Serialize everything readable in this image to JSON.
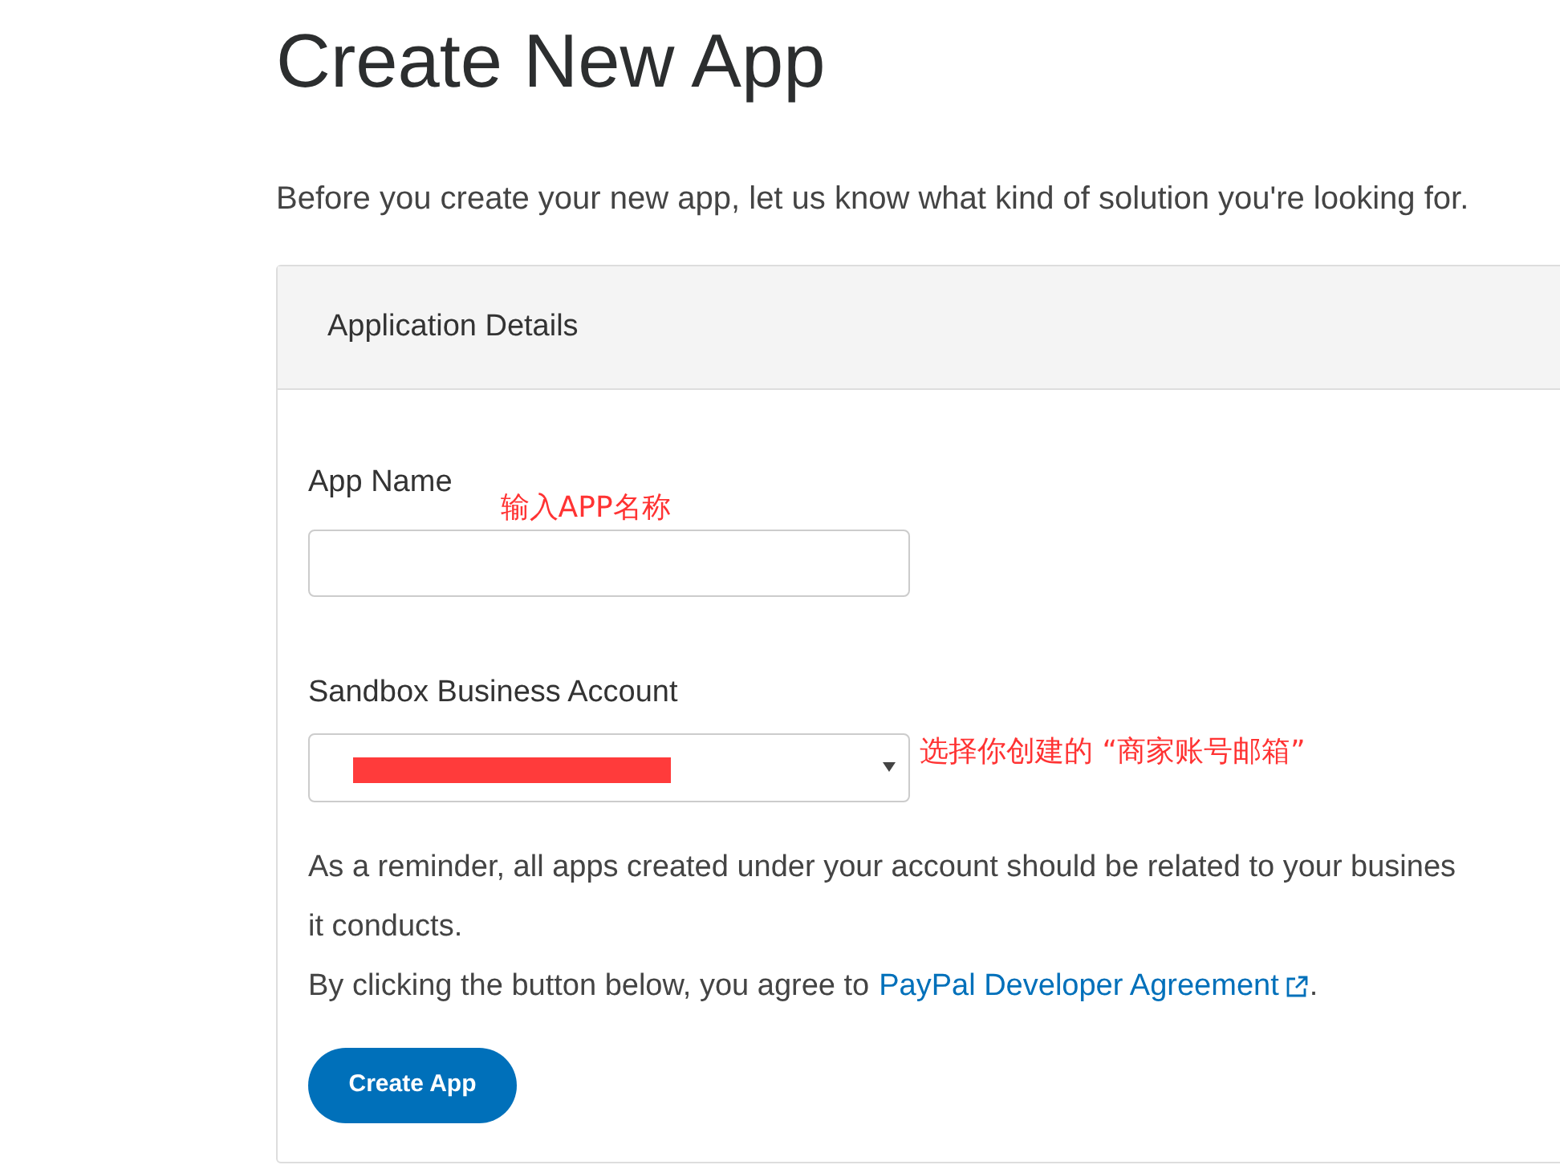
{
  "title": "Create New App",
  "subtitle": "Before you create your new app, let us know what kind of solution you're looking for.",
  "card": {
    "header": "Application Details",
    "app_name": {
      "label": "App Name",
      "annotation": "输入APP名称"
    },
    "account": {
      "label": "Sandbox Business Account",
      "annotation": "选择你创建的 “商家账号邮箱”"
    },
    "reminder_lines": [
      "As a reminder, all apps created under your account should be related to your busines",
      "it conducts."
    ],
    "agreement": {
      "text": "By clicking the button below, you agree to",
      "link": "PayPal Developer Agreement",
      "end": "."
    },
    "button": "Create App"
  }
}
